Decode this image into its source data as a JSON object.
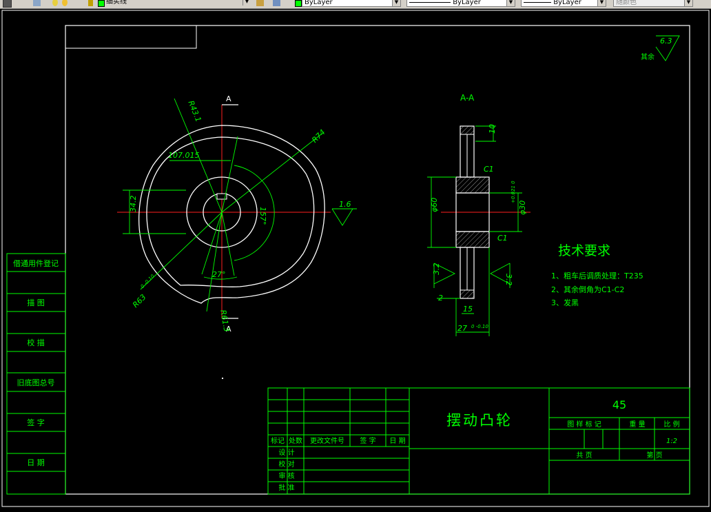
{
  "toolbar": {
    "layer_name": "细实线",
    "color_value": "ByLayer",
    "linetype_value": "ByLayer",
    "lineweight_value": "ByLayer",
    "plotstyle_value": "随颜色"
  },
  "drawing": {
    "section_title": "A-A",
    "section_marker": "A",
    "dims_front": {
      "r43": "R43.1",
      "r74": "R74",
      "d107": "107.015",
      "d342": "34.2",
      "ang157": "157°",
      "ang27": "27°",
      "r63": "R63",
      "r63_tol": "0 -0.10",
      "r61": "R61.3",
      "rough16": "1.6"
    },
    "dims_section": {
      "d10": "10",
      "c1a": "C1",
      "c1b": "C1",
      "d60": "φ60",
      "d30": "φ30",
      "d30_tol": "+0.021 0",
      "d32a": "3.2",
      "d32b": "3.2",
      "d2": "2",
      "d15": "15",
      "d27": "27",
      "d27_tol": "0 -0.10"
    },
    "roughness_other": {
      "value": "6.3",
      "label": "其余"
    },
    "tech_req": {
      "title": "技术要求",
      "items": [
        "1、粗车后调质处理：T235",
        "2、其余倒角为C1-C2",
        "3、发黑"
      ]
    }
  },
  "title_block": {
    "drawing_name": "摆动凸轮",
    "material": "45",
    "headers": [
      "标记",
      "处数",
      "更改文件号",
      "签 字",
      "日 期"
    ],
    "roles": [
      "设 计",
      "校 对",
      "审 核",
      "批 准"
    ],
    "right_headers": [
      "图 样 标 记",
      "重 量",
      "比 例"
    ],
    "scale": "1:2",
    "sheet_total": "共       页",
    "sheet_no": "第       页"
  },
  "side_column": {
    "labels": [
      "借通用件登记",
      "描 图",
      "校 描",
      "旧底图总号",
      "签 字",
      "日 期"
    ]
  }
}
